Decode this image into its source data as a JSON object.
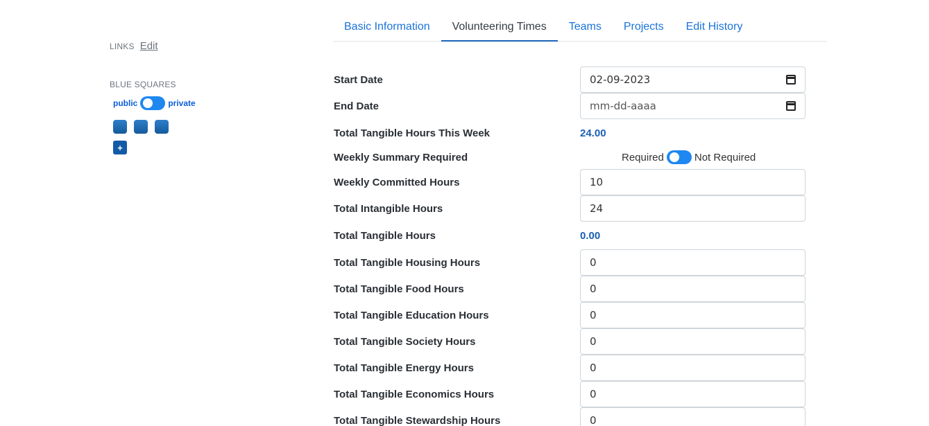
{
  "sidebar": {
    "links_label": "LINKS",
    "links_edit": "Edit",
    "blue_squares_label": "BLUE SQUARES",
    "privacy_left": "public",
    "privacy_right": "private",
    "squares_count": 3,
    "add_label": "+"
  },
  "tabs": [
    {
      "label": "Basic Information",
      "active": false
    },
    {
      "label": "Volunteering Times",
      "active": true
    },
    {
      "label": "Teams",
      "active": false
    },
    {
      "label": "Projects",
      "active": false
    },
    {
      "label": "Edit History",
      "active": false
    }
  ],
  "form": {
    "start_date": {
      "label": "Start Date",
      "value": "02-09-2023"
    },
    "end_date": {
      "label": "End Date",
      "placeholder": "mm-dd-aaaa"
    },
    "tangible_week": {
      "label": "Total Tangible Hours This Week",
      "value": "24.00"
    },
    "weekly_summary": {
      "label": "Weekly Summary Required",
      "left": "Required",
      "right": "Not Required"
    },
    "weekly_committed": {
      "label": "Weekly Committed Hours",
      "value": "10"
    },
    "intangible": {
      "label": "Total Intangible Hours",
      "value": "24"
    },
    "tangible_total": {
      "label": "Total Tangible Hours",
      "value": "0.00"
    },
    "housing": {
      "label": "Total Tangible Housing Hours",
      "value": "0"
    },
    "food": {
      "label": "Total Tangible Food Hours",
      "value": "0"
    },
    "education": {
      "label": "Total Tangible Education Hours",
      "value": "0"
    },
    "society": {
      "label": "Total Tangible Society Hours",
      "value": "0"
    },
    "energy": {
      "label": "Total Tangible Energy Hours",
      "value": "0"
    },
    "economics": {
      "label": "Total Tangible Economics Hours",
      "value": "0"
    },
    "stewardship": {
      "label": "Total Tangible Stewardship Hours",
      "value": "0"
    }
  },
  "colors": {
    "link_blue": "#1a73d9",
    "toggle_blue": "#1e88f0",
    "square_blue": "#155a9c"
  }
}
